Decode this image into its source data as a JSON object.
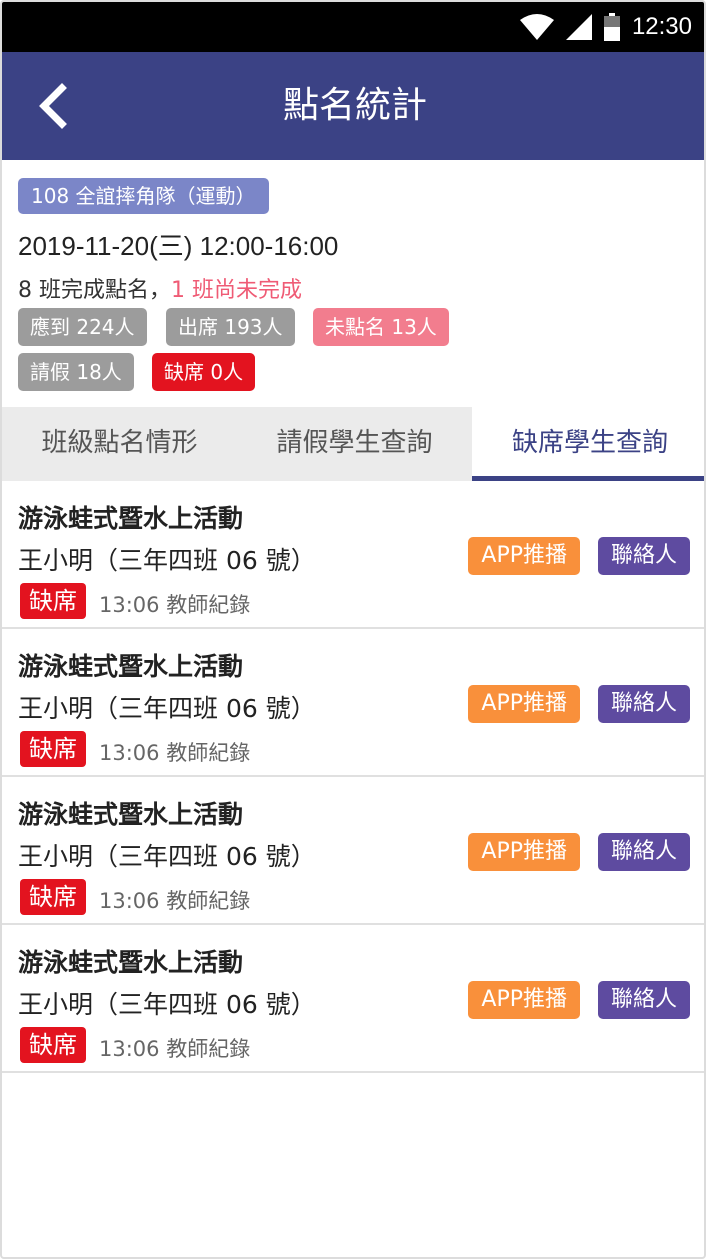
{
  "status_bar": {
    "time": "12:30"
  },
  "app_bar": {
    "title": "點名統計"
  },
  "info": {
    "group_badge": "108  全誼摔角隊（運動）",
    "datetime": "2019-11-20(三) 12:00-16:00",
    "completed_text": "8 班完成點名，",
    "pending_text": "1 班尚未完成",
    "chips": {
      "expected": "應到 224人",
      "present": "出席 193人",
      "not_called": "未點名 13人",
      "leave": "請假 18人",
      "absent": "缺席 0人"
    }
  },
  "tabs": [
    {
      "label": "班級點名情形"
    },
    {
      "label": "請假學生查詢"
    },
    {
      "label": "缺席學生查詢"
    }
  ],
  "items": [
    {
      "activity": "游泳蛙式暨水上活動",
      "student": "王小明（三年四班 06 號）",
      "status": "缺席",
      "record": "13:06 教師紀錄",
      "push_label": "APP推播",
      "contact_label": "聯絡人"
    },
    {
      "activity": "游泳蛙式暨水上活動",
      "student": "王小明（三年四班 06 號）",
      "status": "缺席",
      "record": "13:06 教師紀錄",
      "push_label": "APP推播",
      "contact_label": "聯絡人"
    },
    {
      "activity": "游泳蛙式暨水上活動",
      "student": "王小明（三年四班 06 號）",
      "status": "缺席",
      "record": "13:06 教師紀錄",
      "push_label": "APP推播",
      "contact_label": "聯絡人"
    },
    {
      "activity": "游泳蛙式暨水上活動",
      "student": "王小明（三年四班 06 號）",
      "status": "缺席",
      "record": "13:06 教師紀錄",
      "push_label": "APP推播",
      "contact_label": "聯絡人"
    }
  ],
  "icons": {
    "status": [
      "wifi-icon",
      "signal-icon",
      "battery-icon"
    ],
    "back": "back-arrow-icon"
  },
  "colors": {
    "app_bar": "#3b4285",
    "group_badge": "#7b86c8",
    "pending": "#ef5b75",
    "chip_gray": "#9c9c9c",
    "chip_pink": "#f27d8e",
    "absent_red": "#e3131f",
    "push_button": "#f9903b",
    "contact_button": "#5e4ba0"
  },
  "active_tab": "缺席學生查詢"
}
